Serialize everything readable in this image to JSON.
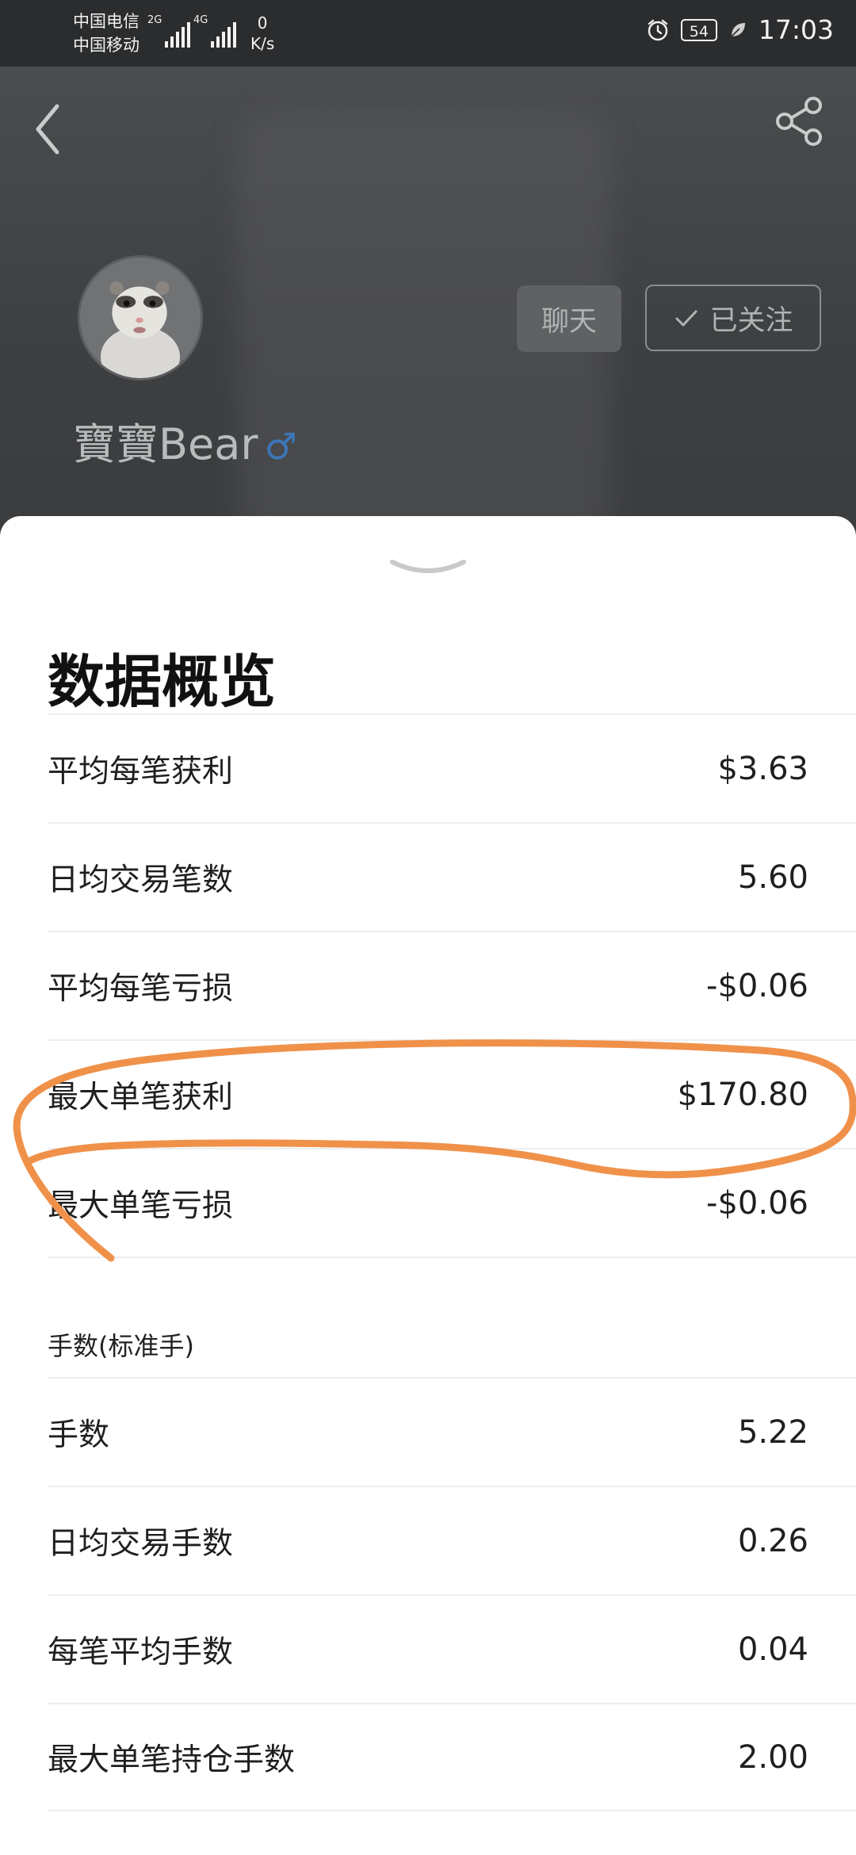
{
  "status_bar": {
    "carrier_1": "中国电信",
    "carrier_2": "中国移动",
    "sim1_tag": "2G",
    "sim2_tag": "4G",
    "net_speed_value": "0",
    "net_speed_unit": "K/s",
    "battery": "54",
    "time": "17:03"
  },
  "profile": {
    "username": "寶寶Bear",
    "gender_symbol": "♂",
    "chat_label": "聊天",
    "follow_label": "已关注"
  },
  "sheet": {
    "title": "数据概览",
    "stats": [
      {
        "label": "平均每笔获利",
        "value": "$3.63"
      },
      {
        "label": "日均交易笔数",
        "value": "5.60"
      },
      {
        "label": "平均每笔亏损",
        "value": "-$0.06"
      },
      {
        "label": "最大单笔获利",
        "value": "$170.80"
      },
      {
        "label": "最大单笔亏损",
        "value": "-$0.06"
      }
    ],
    "lots_section_label": "手数(标准手)",
    "lots": [
      {
        "label": "手数",
        "value": "5.22"
      },
      {
        "label": "日均交易手数",
        "value": "0.26"
      },
      {
        "label": "每笔平均手数",
        "value": "0.04"
      },
      {
        "label": "最大单笔持仓手数",
        "value": "2.00"
      }
    ]
  },
  "colors": {
    "annotation": "#f0914a",
    "sheet_bg": "#ffffff",
    "header_bg": "#3d3f41"
  }
}
